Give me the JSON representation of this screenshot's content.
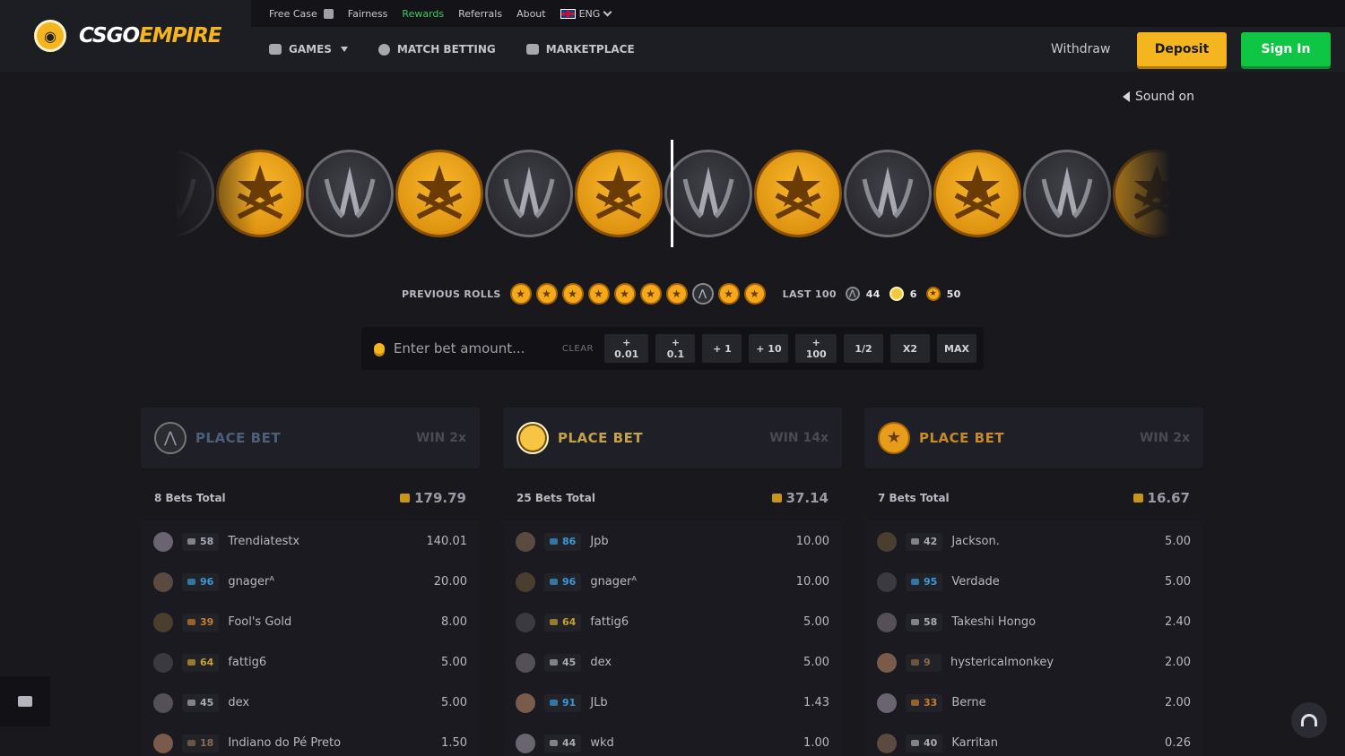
{
  "brand": {
    "name_part1": "CSGO",
    "name_part2": "EMPIRE"
  },
  "top_links": {
    "free_case": "Free Case",
    "fairness": "Fairness",
    "rewards": "Rewards",
    "referrals": "Referrals",
    "about": "About",
    "language": "ENG"
  },
  "nav": {
    "games": "GAMES",
    "match_betting": "MATCH BETTING",
    "marketplace": "MARKETPLACE"
  },
  "header_buttons": {
    "withdraw": "Withdraw",
    "deposit": "Deposit",
    "sign_in": "Sign In"
  },
  "sound_label": "Sound on",
  "roller_sequence": [
    "ct",
    "t",
    "ct",
    "t",
    "ct",
    "t",
    "ct",
    "t",
    "ct",
    "t",
    "ct",
    "t"
  ],
  "previous_rolls": {
    "label": "PREVIOUS ROLLS",
    "rolls": [
      "t",
      "t",
      "t",
      "t",
      "t",
      "t",
      "t",
      "ct",
      "t",
      "t"
    ],
    "last100_label": "LAST 100",
    "last100": {
      "ct": "44",
      "bonus": "6",
      "t": "50"
    }
  },
  "bet": {
    "placeholder": "Enter bet amount...",
    "clear": "CLEAR",
    "quick_buttons": [
      "+ 0.01",
      "+ 0.1",
      "+ 1",
      "+ 10",
      "+ 100",
      "1/2",
      "X2",
      "MAX"
    ]
  },
  "columns": [
    {
      "side": "ct",
      "label": "PLACE BET",
      "win": "WIN 2x",
      "total_label": "8 Bets Total",
      "total_amount": "179.79",
      "rows": [
        {
          "level": "58",
          "name": "Trendiatestx",
          "amount": "140.01",
          "lvl_color": "#a9a9b4"
        },
        {
          "level": "96",
          "name": "gnagerᴬ",
          "amount": "20.00",
          "lvl_color": "#3a9ad9"
        },
        {
          "level": "39",
          "name": "Fool's Gold",
          "amount": "8.00",
          "lvl_color": "#c97c2e"
        },
        {
          "level": "64",
          "name": "fattig6",
          "amount": "5.00",
          "lvl_color": "#c9a12e"
        },
        {
          "level": "45",
          "name": "dex",
          "amount": "5.00",
          "lvl_color": "#a9a9b4"
        },
        {
          "level": "18",
          "name": "Indiano do Pé Preto",
          "amount": "1.50",
          "lvl_color": "#8a6b4c"
        }
      ]
    },
    {
      "side": "bonus",
      "label": "PLACE BET",
      "win": "WIN 14x",
      "total_label": "25 Bets Total",
      "total_amount": "37.14",
      "rows": [
        {
          "level": "86",
          "name": "Jpb",
          "amount": "10.00",
          "lvl_color": "#3a9ad9"
        },
        {
          "level": "96",
          "name": "gnagerᴬ",
          "amount": "10.00",
          "lvl_color": "#3a9ad9"
        },
        {
          "level": "64",
          "name": "fattig6",
          "amount": "5.00",
          "lvl_color": "#c9a12e"
        },
        {
          "level": "45",
          "name": "dex",
          "amount": "5.00",
          "lvl_color": "#a9a9b4"
        },
        {
          "level": "91",
          "name": "JLb",
          "amount": "1.43",
          "lvl_color": "#3a9ad9"
        },
        {
          "level": "44",
          "name": "wkd",
          "amount": "1.00",
          "lvl_color": "#a9a9b4"
        }
      ]
    },
    {
      "side": "t",
      "label": "PLACE BET",
      "win": "WIN 2x",
      "total_label": "7 Bets Total",
      "total_amount": "16.67",
      "rows": [
        {
          "level": "42",
          "name": "Jackson.",
          "amount": "5.00",
          "lvl_color": "#a9a9b4"
        },
        {
          "level": "95",
          "name": "Verdade",
          "amount": "5.00",
          "lvl_color": "#3a9ad9"
        },
        {
          "level": "58",
          "name": "Takeshi Hongo",
          "amount": "2.40",
          "lvl_color": "#a9a9b4"
        },
        {
          "level": "9",
          "name": "hystericalmonkey",
          "amount": "2.00",
          "lvl_color": "#8a6b4c"
        },
        {
          "level": "33",
          "name": "Berne",
          "amount": "2.00",
          "lvl_color": "#c97c2e"
        },
        {
          "level": "40",
          "name": "Karritan",
          "amount": "0.26",
          "lvl_color": "#a9a9b4"
        }
      ]
    }
  ]
}
